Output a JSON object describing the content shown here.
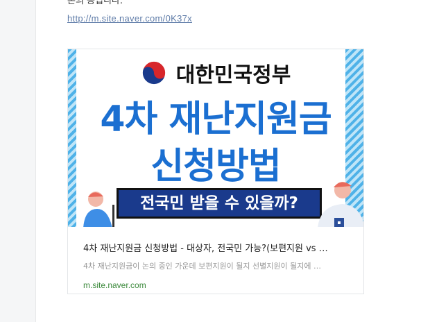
{
  "post": {
    "cut_text": "돈의 공입니다.",
    "link_url": "http://m.site.naver.com/0K37x"
  },
  "card": {
    "thumbnail": {
      "gov_name": "대한민국정부",
      "title_line1": "4차 재난지원금",
      "title_line2": "신청방법",
      "banner_text": "전국민 받을 수 있을까?"
    },
    "title": "4차 재난지원금 신청방법 - 대상자, 전국민 가능?(보편지원 vs …",
    "description": "4차 재난지원금이 논의 중인 가운데 보편지원이 될지 선별지원이 될지에 …",
    "domain": "m.site.naver.com"
  },
  "colors": {
    "link": "#5f7ca8",
    "domain": "#3d8a3d",
    "title_blue": "#1b6fd1",
    "banner_navy": "#1a3a8c"
  }
}
